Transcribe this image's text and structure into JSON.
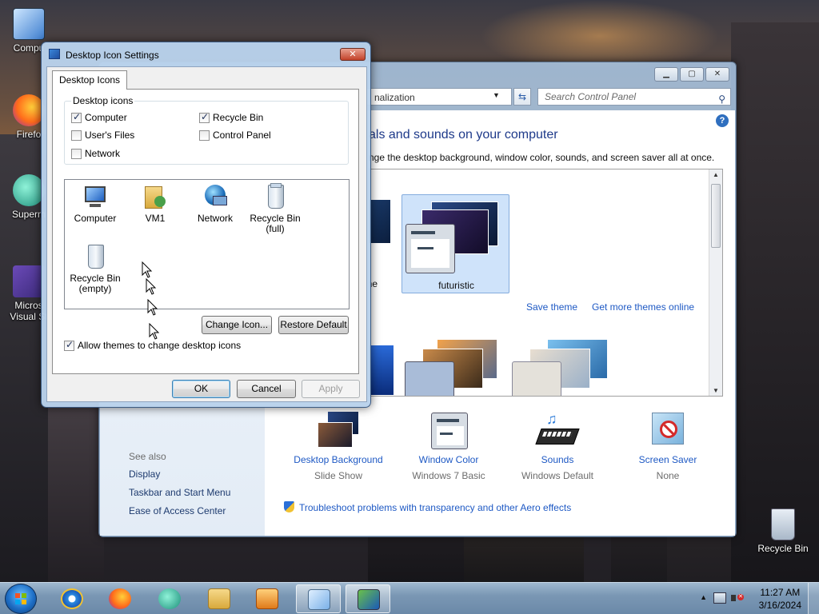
{
  "desktop": {
    "icons": [
      {
        "label": "Compu"
      },
      {
        "label": "Firefo"
      },
      {
        "label": "Superm"
      },
      {
        "label": "Micros"
      },
      {
        "label": "Visual St"
      },
      {
        "label": "Recycle Bin"
      }
    ]
  },
  "control_panel": {
    "address_tail": "nalization",
    "search_placeholder": "Search Control Panel",
    "heading": "als and sounds on your computer",
    "subheading": "nge the desktop background, window color, sounds, and screen saver all at once.",
    "theme_partial_label": "he",
    "selected_theme": "futuristic",
    "save_theme": "Save theme",
    "get_more_themes": "Get more themes online",
    "see_also": "See also",
    "side_links": [
      "Display",
      "Taskbar and Start Menu",
      "Ease of Access Center"
    ],
    "bottom_items": [
      {
        "title": "Desktop Background",
        "sub": "Slide Show"
      },
      {
        "title": "Window Color",
        "sub": "Windows 7 Basic"
      },
      {
        "title": "Sounds",
        "sub": "Windows Default"
      },
      {
        "title": "Screen Saver",
        "sub": "None"
      }
    ],
    "troubleshoot": "Troubleshoot problems with transparency and other Aero effects"
  },
  "dialog": {
    "title": "Desktop Icon Settings",
    "tab": "Desktop Icons",
    "group_label": "Desktop icons",
    "checkboxes": [
      {
        "label": "Computer",
        "checked": true
      },
      {
        "label": "Recycle Bin",
        "checked": true
      },
      {
        "label": "User's Files",
        "checked": false
      },
      {
        "label": "Control Panel",
        "checked": false
      },
      {
        "label": "Network",
        "checked": false
      }
    ],
    "icons": [
      {
        "label": "Computer"
      },
      {
        "label": "VM1"
      },
      {
        "label": "Network"
      },
      {
        "label": "Recycle Bin (full)",
        "line1": "Recycle Bin",
        "line2": "(full)"
      },
      {
        "label": "Recycle Bin (empty)",
        "line1": "Recycle Bin",
        "line2": "(empty)"
      }
    ],
    "change_icon": "Change Icon...",
    "restore_default": "Restore Default",
    "allow_themes": {
      "label": "Allow themes to change desktop icons",
      "checked": true
    },
    "ok": "OK",
    "cancel": "Cancel",
    "apply": "Apply"
  },
  "taskbar": {
    "time": "11:27 AM",
    "date": "3/16/2024"
  },
  "colors": {
    "link": "#1e59c4",
    "heading": "#1e3a8a",
    "selection": "#cfe3fa"
  }
}
